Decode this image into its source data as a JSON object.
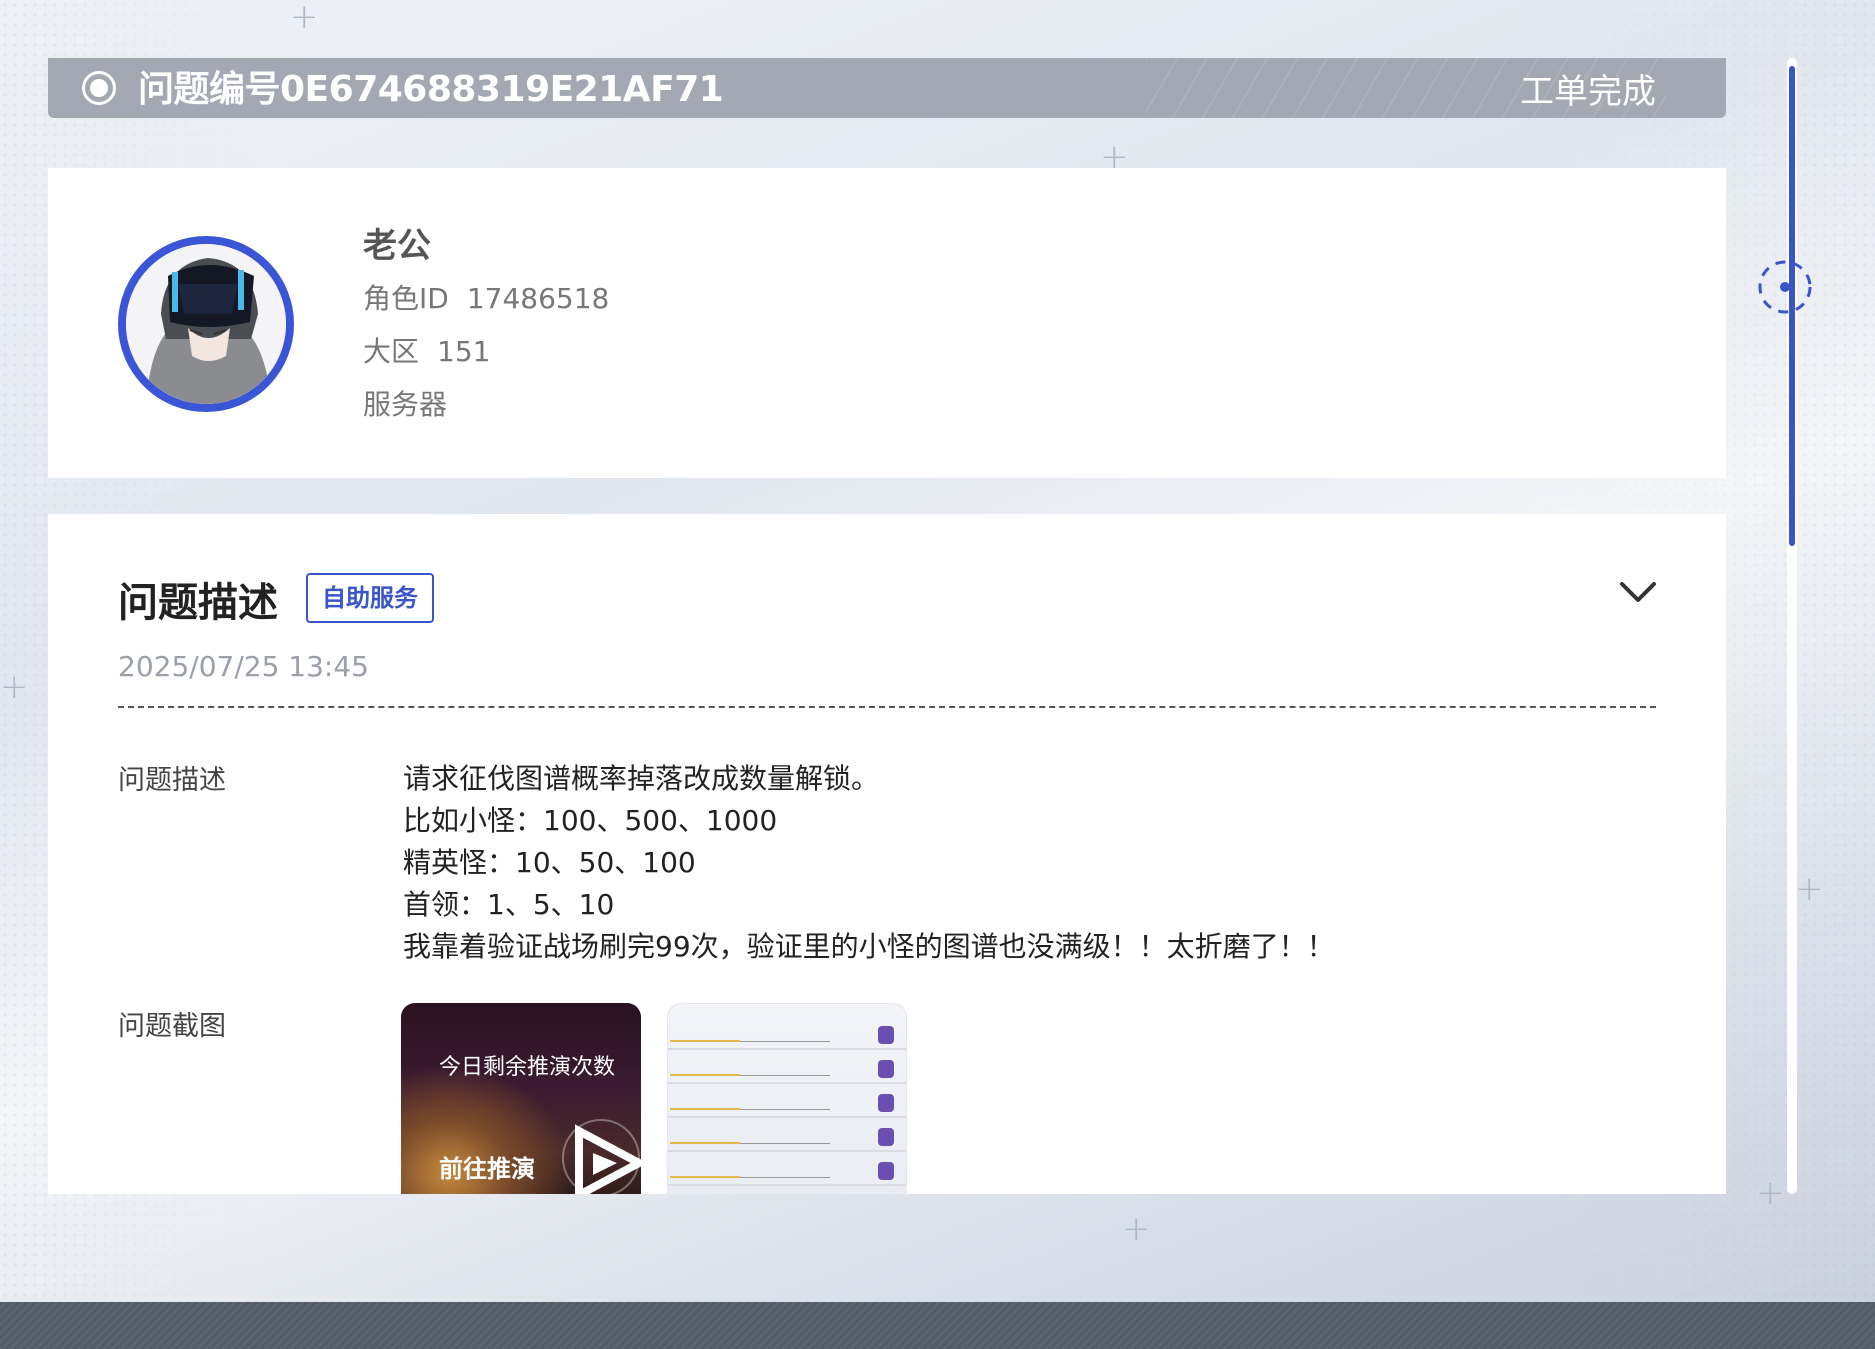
{
  "header": {
    "ticket_id": "问题编号0E674688319E21AF71",
    "status": "工单完成"
  },
  "profile": {
    "nickname": "老公",
    "role_id_label": "角色ID",
    "role_id": "17486518",
    "region_label": "大区",
    "region": "151",
    "server_label": "服务器",
    "server": ""
  },
  "problem": {
    "title": "问题描述",
    "badge": "自助服务",
    "timestamp": "2025/07/25 13:45",
    "description_label": "问题描述",
    "description_lines": [
      "请求征伐图谱概率掉落改成数量解锁。",
      "比如小怪：100、500、1000",
      "精英怪：10、50、100",
      "首领：1、5、10",
      "我靠着验证战场刷完99次，验证里的小怪的图谱也没满级！！太折磨了！！"
    ],
    "screenshot_label": "问题截图",
    "screenshot_1": {
      "text_top": "今日剩余推演次数",
      "text_bottom": "前往推演"
    }
  },
  "colors": {
    "accent": "#3a55c8",
    "header_bg": "#a3a8b3",
    "avatar_ring": "#3a55d6"
  },
  "icons": {
    "status_dot": "radio-icon",
    "collapse": "chevron-down-icon",
    "scroll_knob": "dashed-circle-icon"
  }
}
